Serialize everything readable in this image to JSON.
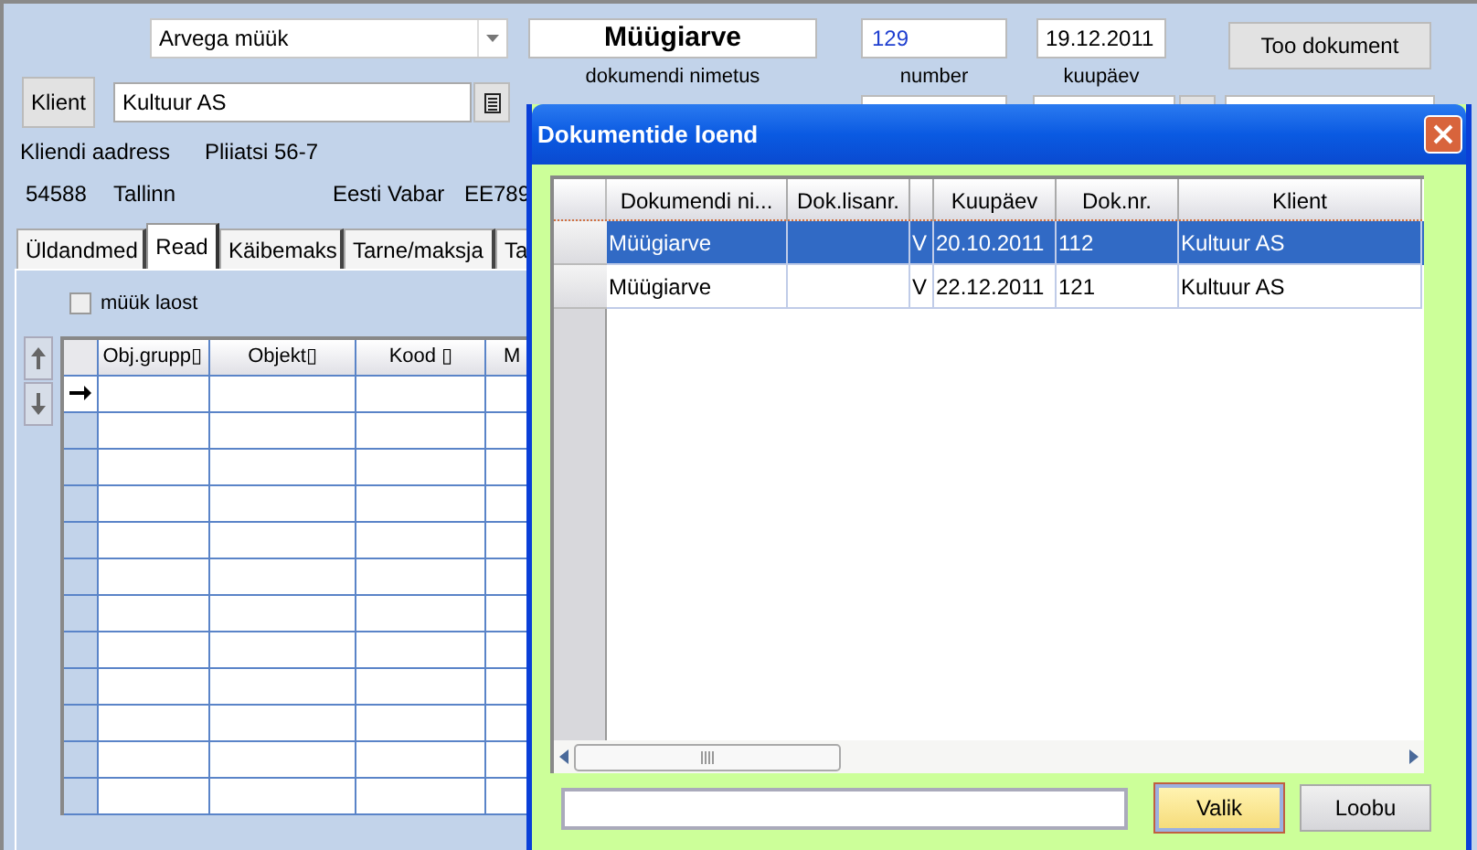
{
  "form": {
    "type_dropdown": {
      "value": "Arvega müük"
    },
    "document_name": {
      "value": "Müügiarve",
      "label": "dokumendi nimetus"
    },
    "number": {
      "value": "129",
      "label": "number"
    },
    "date": {
      "value": "19.12.2011",
      "label": "kuupäev"
    },
    "fetch_button": "Too dokument",
    "client_button": "Klient",
    "client_field": {
      "value": "Kultuur AS"
    },
    "address_label": "Kliendi aadress",
    "address": "Pliiatsi 56-7",
    "postal_code": "54588",
    "city": "Tallinn",
    "bank": "Eesti Vabar",
    "account": "EE789"
  },
  "tabs": [
    {
      "label": "Üldandmed",
      "selected": false
    },
    {
      "label": "Read",
      "selected": true
    },
    {
      "label": "Käibemaks",
      "selected": false
    },
    {
      "label": "Tarne/maksja",
      "selected": false
    },
    {
      "label": "Ta",
      "selected": false
    }
  ],
  "stock_sale": {
    "label": "müük laost",
    "checked": false
  },
  "lines_table": {
    "columns": [
      "Obj.grupp▯",
      "Objekt▯",
      "Kood ▯",
      "M"
    ]
  },
  "dialog": {
    "title": "Dokumentide loend",
    "columns": [
      "Dokumendi ni...",
      "Dok.lisanr.",
      null,
      "Kuupäev",
      "Dok.nr.",
      "Klient"
    ],
    "rows": [
      {
        "selected": true,
        "cells": [
          "Müügiarve",
          null,
          "V",
          "20.10.2011",
          "112",
          "Kultuur AS"
        ]
      },
      {
        "selected": false,
        "cells": [
          "Müügiarve",
          null,
          "V",
          "22.12.2011",
          "121",
          "Kultuur AS"
        ]
      }
    ],
    "buttons": [
      {
        "label": "Valik",
        "focused": true
      },
      {
        "label": "Loobu",
        "focused": false
      }
    ]
  }
}
